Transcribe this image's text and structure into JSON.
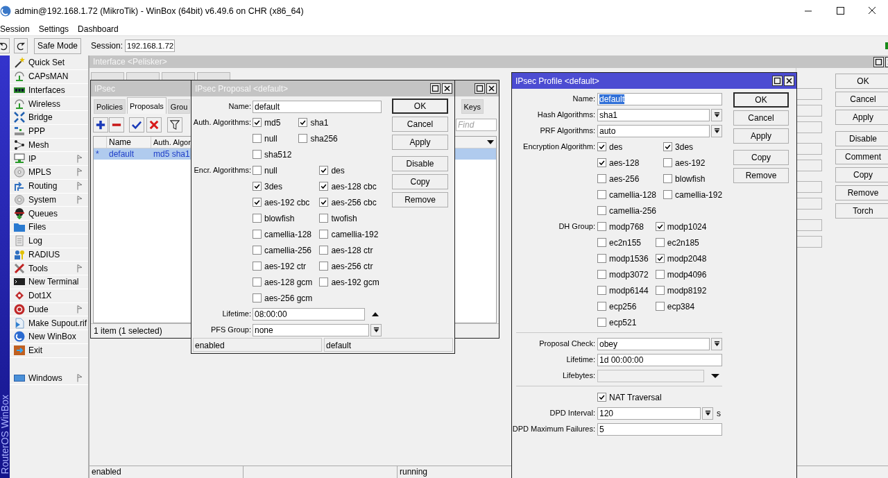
{
  "window": {
    "title": "admin@192.168.1.72 (MikroTik) - WinBox (64bit) v6.49.6 on CHR (x86_64)"
  },
  "menu": [
    "Session",
    "Settings",
    "Dashboard"
  ],
  "toolbar": {
    "safe_mode": "Safe Mode",
    "session_label": "Session:",
    "session_value": "192.168.1.72"
  },
  "sidebar": {
    "brand": "RouterOS WinBox",
    "items": [
      {
        "label": "Quick Set",
        "submenu": false
      },
      {
        "label": "CAPsMAN",
        "submenu": false
      },
      {
        "label": "Interfaces",
        "submenu": false
      },
      {
        "label": "Wireless",
        "submenu": false
      },
      {
        "label": "Bridge",
        "submenu": false
      },
      {
        "label": "PPP",
        "submenu": false
      },
      {
        "label": "Mesh",
        "submenu": false
      },
      {
        "label": "IP",
        "submenu": true
      },
      {
        "label": "MPLS",
        "submenu": true
      },
      {
        "label": "Routing",
        "submenu": true
      },
      {
        "label": "System",
        "submenu": true
      },
      {
        "label": "Queues",
        "submenu": false
      },
      {
        "label": "Files",
        "submenu": false
      },
      {
        "label": "Log",
        "submenu": false
      },
      {
        "label": "RADIUS",
        "submenu": false
      },
      {
        "label": "Tools",
        "submenu": true
      },
      {
        "label": "New Terminal",
        "submenu": false
      },
      {
        "label": "Dot1X",
        "submenu": false
      },
      {
        "label": "Dude",
        "submenu": true
      },
      {
        "label": "Make Supout.rif",
        "submenu": false
      },
      {
        "label": "New WinBox",
        "submenu": false
      },
      {
        "label": "Exit",
        "submenu": false
      }
    ],
    "bottom_items": [
      {
        "label": "Windows",
        "submenu": true
      }
    ]
  },
  "interface_window": {
    "title": "Interface <Pelisker>",
    "active": false,
    "buttons": [
      {
        "label": "OK",
        "default": false
      },
      {
        "label": "Cancel",
        "default": false
      },
      {
        "label": "Apply",
        "default": false
      },
      {
        "label": "Disable",
        "default": false
      },
      {
        "label": "Comment",
        "default": false
      },
      {
        "label": "Copy",
        "default": false
      },
      {
        "label": "Remove",
        "default": false
      },
      {
        "label": "Torch",
        "default": false
      }
    ],
    "status_bar": [
      "enabled",
      "running"
    ]
  },
  "ipsec_window": {
    "title": "IPsec",
    "active": false,
    "tabs": [
      {
        "label": "Policies",
        "selected": false
      },
      {
        "label": "Proposals",
        "selected": true
      },
      {
        "label": "Grou",
        "selected": false
      },
      {
        "label": "Keys",
        "selected": false
      }
    ],
    "find_placeholder": "Find",
    "table": {
      "columns": [
        "Name",
        "Auth. Algor"
      ],
      "rows": [
        {
          "flag": "*",
          "cells": [
            "default",
            "md5 sha1"
          ],
          "selected": true
        }
      ]
    },
    "status": "1 item (1 selected)"
  },
  "proposal_window": {
    "title": "IPsec Proposal <default>",
    "active": false,
    "fields": [
      {
        "kind": "text",
        "label": "Name:",
        "value": "default"
      },
      {
        "kind": "checks",
        "label": "Auth. Algorithms:",
        "options": [
          {
            "label": "md5",
            "checked": true
          },
          {
            "label": "sha1",
            "checked": true
          },
          {
            "label": "null",
            "checked": false
          },
          {
            "label": "sha256",
            "checked": false
          },
          {
            "label": "sha512",
            "checked": false
          }
        ]
      },
      {
        "kind": "checks",
        "label": "Encr. Algorithms:",
        "options": [
          {
            "label": "null",
            "checked": false
          },
          {
            "label": "des",
            "checked": true
          },
          {
            "label": "3des",
            "checked": true
          },
          {
            "label": "aes-128 cbc",
            "checked": true
          },
          {
            "label": "aes-192 cbc",
            "checked": true
          },
          {
            "label": "aes-256 cbc",
            "checked": true
          },
          {
            "label": "blowfish",
            "checked": false
          },
          {
            "label": "twofish",
            "checked": false
          },
          {
            "label": "camellia-128",
            "checked": false
          },
          {
            "label": "camellia-192",
            "checked": false
          },
          {
            "label": "camellia-256",
            "checked": false
          },
          {
            "label": "aes-128 ctr",
            "checked": false
          },
          {
            "label": "aes-192 ctr",
            "checked": false
          },
          {
            "label": "aes-256 ctr",
            "checked": false
          },
          {
            "label": "aes-128 gcm",
            "checked": false
          },
          {
            "label": "aes-192 gcm",
            "checked": false
          },
          {
            "label": "aes-256 gcm",
            "checked": false
          }
        ]
      },
      {
        "kind": "spinner",
        "label": "Lifetime:",
        "value": "08:00:00"
      },
      {
        "kind": "dropdown",
        "label": "PFS Group:",
        "value": "none"
      }
    ],
    "buttons": [
      {
        "label": "OK",
        "default": true
      },
      {
        "label": "Cancel",
        "default": false
      },
      {
        "label": "Apply",
        "default": false
      },
      {
        "label": "Disable",
        "default": false
      },
      {
        "label": "Copy",
        "default": false
      },
      {
        "label": "Remove",
        "default": false
      }
    ],
    "status_bar": [
      "enabled",
      "default"
    ]
  },
  "profile_window": {
    "title": "IPsec Profile <default>",
    "active": true,
    "fields": [
      {
        "kind": "text",
        "label": "Name:",
        "value": "default",
        "highlighted": true
      },
      {
        "kind": "dropdown",
        "label": "Hash Algorithms:",
        "value": "sha1"
      },
      {
        "kind": "dropdown",
        "label": "PRF Algorithms:",
        "value": "auto"
      },
      {
        "kind": "checks",
        "label": "Encryption Algorithm:",
        "options": [
          {
            "label": "des",
            "checked": true
          },
          {
            "label": "3des",
            "checked": true
          },
          {
            "label": "aes-128",
            "checked": true
          },
          {
            "label": "aes-192",
            "checked": false
          },
          {
            "label": "aes-256",
            "checked": false
          },
          {
            "label": "blowfish",
            "checked": false
          },
          {
            "label": "camellia-128",
            "checked": false
          },
          {
            "label": "camellia-192",
            "checked": false
          },
          {
            "label": "camellia-256",
            "checked": false
          }
        ]
      },
      {
        "kind": "checks",
        "label": "DH Group:",
        "options": [
          {
            "label": "modp768",
            "checked": false
          },
          {
            "label": "modp1024",
            "checked": true
          },
          {
            "label": "ec2n155",
            "checked": false
          },
          {
            "label": "ec2n185",
            "checked": false
          },
          {
            "label": "modp1536",
            "checked": false
          },
          {
            "label": "modp2048",
            "checked": true
          },
          {
            "label": "modp3072",
            "checked": false
          },
          {
            "label": "modp4096",
            "checked": false
          },
          {
            "label": "modp6144",
            "checked": false
          },
          {
            "label": "modp8192",
            "checked": false
          },
          {
            "label": "ecp256",
            "checked": false
          },
          {
            "label": "ecp384",
            "checked": false
          },
          {
            "label": "ecp521",
            "checked": false
          }
        ]
      },
      {
        "kind": "separator"
      },
      {
        "kind": "dropdown",
        "label": "Proposal Check:",
        "value": "obey"
      },
      {
        "kind": "text",
        "label": "Lifetime:",
        "value": "1d 00:00:00"
      },
      {
        "kind": "optional",
        "label": "Lifebytes:"
      },
      {
        "kind": "separator"
      },
      {
        "kind": "checkbox",
        "label": "NAT Traversal",
        "checked": true
      },
      {
        "kind": "dropdown",
        "label": "DPD Interval:",
        "value": "120",
        "unit": "s"
      },
      {
        "kind": "text",
        "label": "DPD Maximum Failures:",
        "value": "5"
      }
    ],
    "buttons": [
      {
        "label": "OK",
        "default": true
      },
      {
        "label": "Cancel",
        "default": false
      },
      {
        "label": "Apply",
        "default": false
      },
      {
        "label": "Copy",
        "default": false
      },
      {
        "label": "Remove",
        "default": false
      }
    ]
  }
}
